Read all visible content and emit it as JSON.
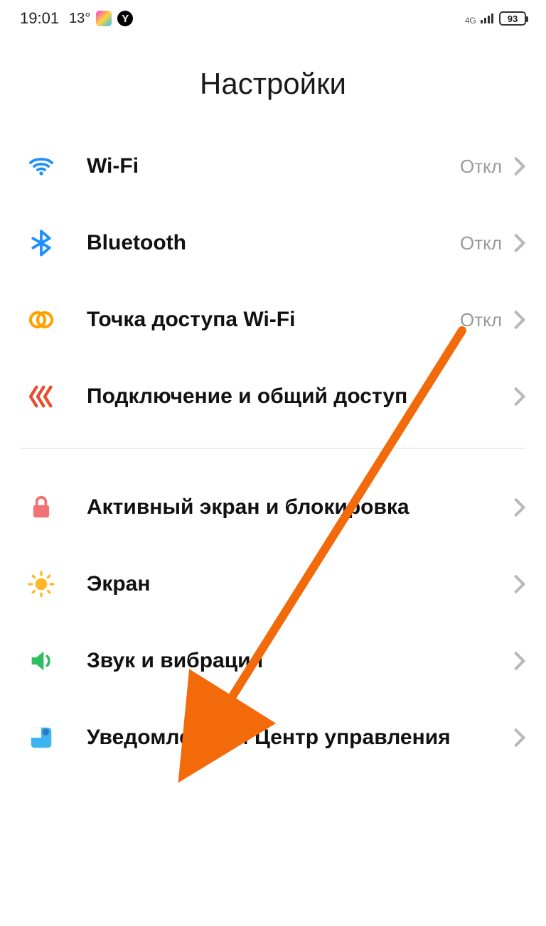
{
  "status_bar": {
    "time": "19:01",
    "temperature": "13°",
    "network_label": "4G",
    "battery_level": "93"
  },
  "title": "Настройки",
  "group1": {
    "wifi": {
      "label": "Wi-Fi",
      "status": "Откл"
    },
    "bluetooth": {
      "label": "Bluetooth",
      "status": "Откл"
    },
    "hotspot": {
      "label": "Точка доступа Wi-Fi",
      "status": "Откл"
    },
    "sharing": {
      "label": "Подключение и общий доступ"
    }
  },
  "group2": {
    "lockscreen": {
      "label": "Активный экран и блокировка"
    },
    "display": {
      "label": "Экран"
    },
    "sound": {
      "label": "Звук и вибрация"
    },
    "notifications": {
      "label": "Уведомления и Центр управления"
    }
  }
}
